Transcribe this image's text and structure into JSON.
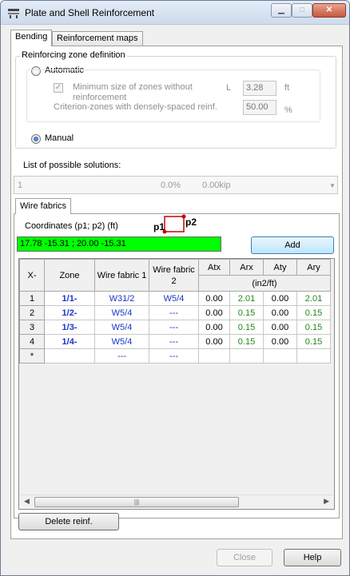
{
  "window": {
    "title": "Plate and Shell Reinforcement"
  },
  "tabs": [
    {
      "label": "Bending"
    },
    {
      "label": "Reinforcement maps"
    }
  ],
  "zone_definition": {
    "title": "Reinforcing zone definition",
    "automatic_label": "Automatic",
    "min_size_label": "Minimum size of zones without reinforcement",
    "min_size_symbol": "L",
    "min_size_value": "3.28",
    "min_size_unit": "ft",
    "criterion_label": "Criterion-zones with densely-spaced reinf.",
    "criterion_value": "50.00",
    "criterion_unit": "%",
    "manual_label": "Manual",
    "selected": "manual"
  },
  "solutions": {
    "label": "List of possible solutions:",
    "index": "1",
    "percent": "0.0%",
    "weight": "0.00kip"
  },
  "wire_fabrics": {
    "tab_label": "Wire fabrics",
    "coords_label": "Coordinates (p1; p2) (ft)",
    "p1": "p1",
    "p2": "p2",
    "coords_value": "17.78  -15.31  ;  20.00  -15.31",
    "add_label": "Add",
    "delete_label": "Delete reinf."
  },
  "table": {
    "headers": {
      "x": "X-",
      "zone": "Zone",
      "fabric1": "Wire fabric 1",
      "fabric2": "Wire fabric 2",
      "atx": "Atx",
      "arx": "Arx",
      "aty": "Aty",
      "ary": "Ary",
      "unit": "(in2/ft)"
    },
    "rows": [
      {
        "n": "1",
        "zone": "1/1-",
        "f1": "W31/2",
        "f2": "W5/4",
        "atx": "0.00",
        "arx": "2.01",
        "aty": "0.00",
        "ary": "2.01"
      },
      {
        "n": "2",
        "zone": "1/2-",
        "f1": "W5/4",
        "f2": "---",
        "atx": "0.00",
        "arx": "0.15",
        "aty": "0.00",
        "ary": "0.15"
      },
      {
        "n": "3",
        "zone": "1/3-",
        "f1": "W5/4",
        "f2": "---",
        "atx": "0.00",
        "arx": "0.15",
        "aty": "0.00",
        "ary": "0.15"
      },
      {
        "n": "4",
        "zone": "1/4-",
        "f1": "W5/4",
        "f2": "---",
        "atx": "0.00",
        "arx": "0.15",
        "aty": "0.00",
        "ary": "0.15"
      },
      {
        "n": "*",
        "zone": "",
        "f1": "---",
        "f2": "---",
        "atx": "",
        "arx": "",
        "aty": "",
        "ary": ""
      }
    ]
  },
  "buttons": {
    "close": "Close",
    "help": "Help"
  },
  "colors": {
    "coords_bg": "#00ff00",
    "zone_text": "#1a36c8",
    "green_values": "#1e8a1e"
  }
}
